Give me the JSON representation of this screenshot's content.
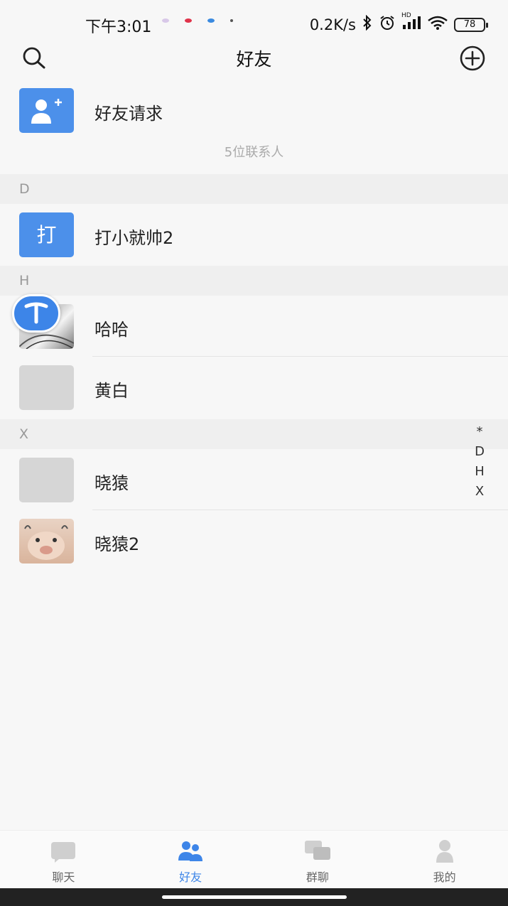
{
  "status_bar": {
    "time": "下午3:01",
    "net_speed": "0.2K/s",
    "network": "HD",
    "battery": "78"
  },
  "header": {
    "title": "好友",
    "search_icon": "search-icon",
    "add_icon": "add-circle-icon"
  },
  "friend_request": {
    "label": "好友请求",
    "icon": "add-user-icon",
    "color": "#3d85e8"
  },
  "contact_count": "5位联系人",
  "sections": [
    {
      "letter": "D",
      "contacts": [
        {
          "name": "打小就帅2",
          "avatar_text": "打"
        }
      ]
    },
    {
      "letter": "H",
      "contacts": [
        {
          "name": "哈哈",
          "avatar": "photo"
        },
        {
          "name": "黄白",
          "avatar": "placeholder"
        }
      ]
    },
    {
      "letter": "X",
      "contacts": [
        {
          "name": "晓猿",
          "avatar": "placeholder"
        },
        {
          "name": "晓猿2",
          "avatar": "photo"
        }
      ]
    }
  ],
  "index_bar": [
    "*",
    "D",
    "H",
    "X"
  ],
  "tabs": [
    {
      "label": "聊天",
      "icon": "chat-icon",
      "active": false
    },
    {
      "label": "好友",
      "icon": "friends-icon",
      "active": true
    },
    {
      "label": "群聊",
      "icon": "group-chat-icon",
      "active": false
    },
    {
      "label": "我的",
      "icon": "profile-icon",
      "active": false
    }
  ],
  "colors": {
    "accent": "#3d85e8",
    "background": "#f7f7f7",
    "section_bg": "#efefef"
  }
}
